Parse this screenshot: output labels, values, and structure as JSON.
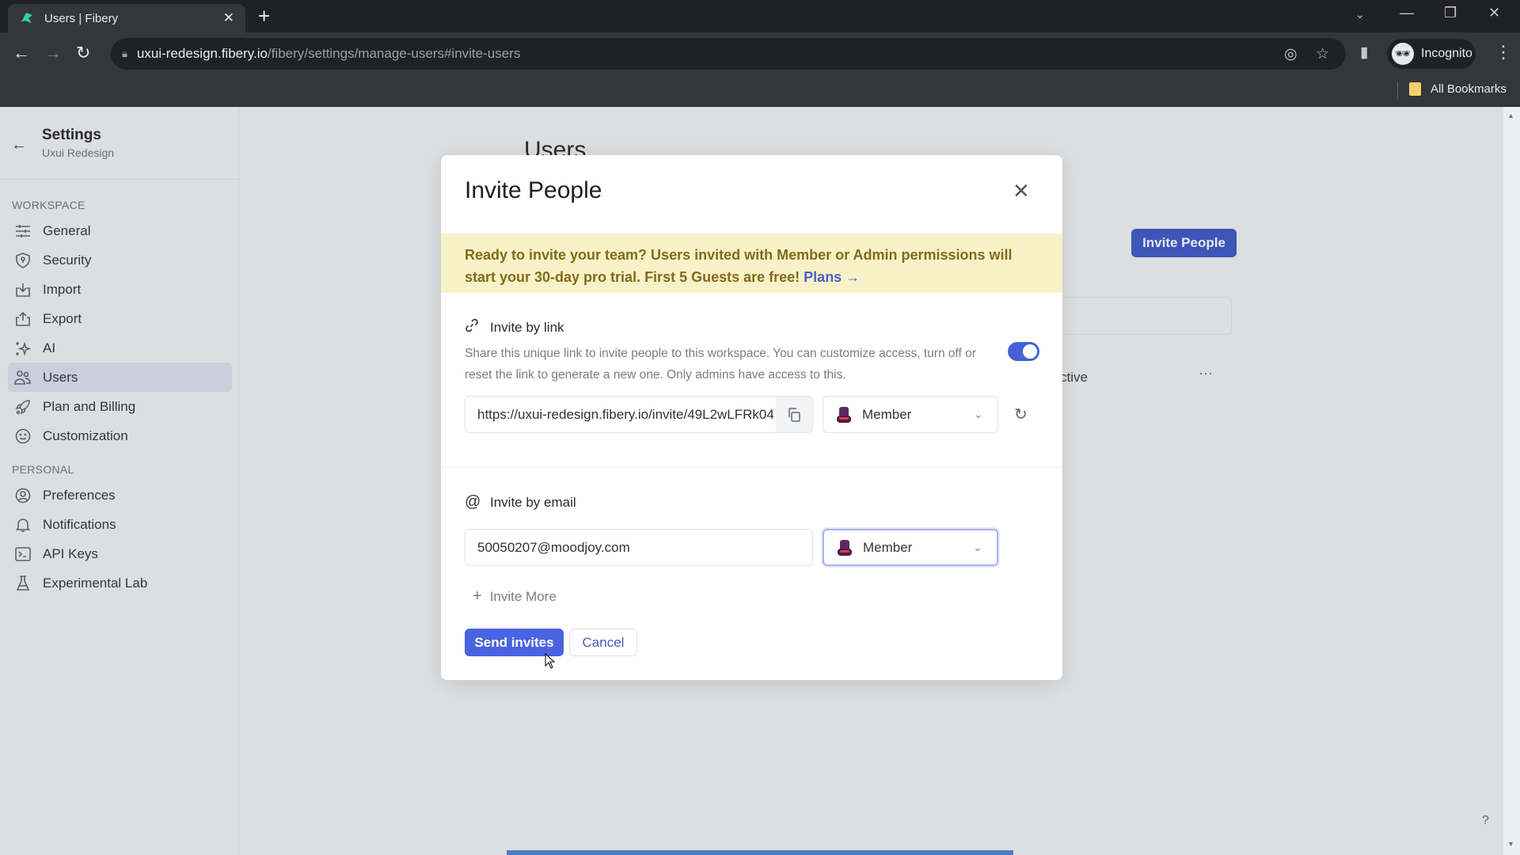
{
  "browser": {
    "tab_title": "Users | Fibery",
    "url_host": "uxui-redesign.fibery.io",
    "url_path": "/fibery/settings/manage-users#invite-users",
    "profile_label": "Incognito",
    "bookmarks_label": "All Bookmarks"
  },
  "sidebar": {
    "title": "Settings",
    "subtitle": "Uxui Redesign",
    "sections": [
      {
        "label": "WORKSPACE",
        "items": [
          {
            "label": "General",
            "icon": "sliders-icon"
          },
          {
            "label": "Security",
            "icon": "shield-icon"
          },
          {
            "label": "Import",
            "icon": "import-icon"
          },
          {
            "label": "Export",
            "icon": "export-icon"
          },
          {
            "label": "AI",
            "icon": "sparkles-icon"
          },
          {
            "label": "Users",
            "icon": "users-icon",
            "active": true
          },
          {
            "label": "Plan and Billing",
            "icon": "rocket-icon"
          },
          {
            "label": "Customization",
            "icon": "smiley-icon"
          }
        ]
      },
      {
        "label": "PERSONAL",
        "items": [
          {
            "label": "Preferences",
            "icon": "user-circle-icon"
          },
          {
            "label": "Notifications",
            "icon": "bell-icon"
          },
          {
            "label": "API Keys",
            "icon": "terminal-icon"
          },
          {
            "label": "Experimental Lab",
            "icon": "flask-icon"
          }
        ]
      }
    ]
  },
  "background": {
    "page_title": "Users",
    "invite_button": "Invite People",
    "status_fragment": "ctive",
    "more_label": "···",
    "help_label": "?"
  },
  "modal": {
    "title": "Invite People",
    "banner_text": "Ready to invite your team? Users invited with Member or Admin permissions will start your 30-day pro trial. First 5 Guests are free!",
    "banner_link": "Plans →",
    "link_section": {
      "title": "Invite by link",
      "description": "Share this unique link to invite people to this workspace. You can customize access, turn off or reset the link to generate a new one. Only admins have access to this.",
      "enabled": true,
      "link_value": "https://uxui-redesign.fibery.io/invite/49L2wLFRk04",
      "role": "Member"
    },
    "email_section": {
      "title": "Invite by email",
      "email_value": "50050207@moodjoy.com",
      "role": "Member",
      "invite_more": "Invite More"
    },
    "send_button": "Send invites",
    "cancel_button": "Cancel"
  },
  "colors": {
    "accent": "#4a63e0",
    "banner_bg": "#f8f2c8",
    "banner_text": "#846a1a",
    "toggle_on": "#4562d8"
  }
}
